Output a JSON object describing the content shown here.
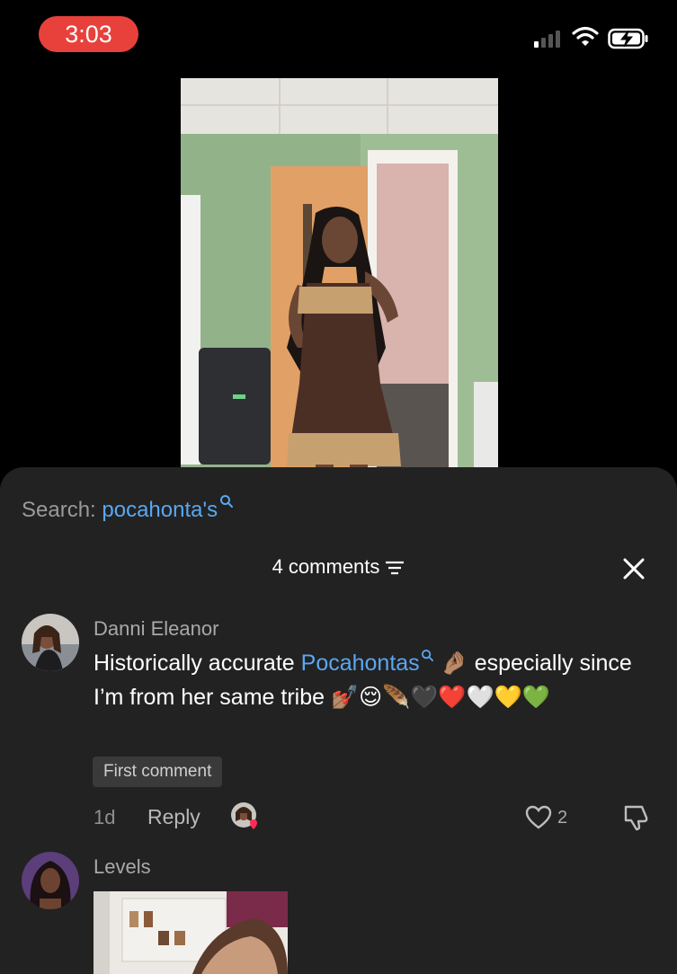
{
  "status_bar": {
    "time": "3:03"
  },
  "search": {
    "prefix": "Search: ",
    "term": "pocahonta's"
  },
  "comments_header": {
    "count_label": "4 comments"
  },
  "comments": [
    {
      "author": "Danni Eleanor",
      "text_before": "Historically accurate ",
      "link": "Pocahontas",
      "emoji_1": "🤌🏽",
      "text_mid": " especially since I’m from her same tribe ",
      "emoji_tail": "💅🏽😌🪶🖤❤️🤍💛💚",
      "badge": "First comment",
      "age": "1d",
      "reply_label": "Reply",
      "likes": "2"
    },
    {
      "author": "Levels"
    }
  ],
  "colors": {
    "accent_link": "#5aa7f0",
    "time_pill": "#e8413c",
    "sheet_bg": "#222222"
  },
  "icons": [
    "signal-icon",
    "wifi-icon",
    "battery-charging-icon",
    "search-icon",
    "filter-icon",
    "close-icon",
    "heart-icon",
    "dislike-icon"
  ]
}
